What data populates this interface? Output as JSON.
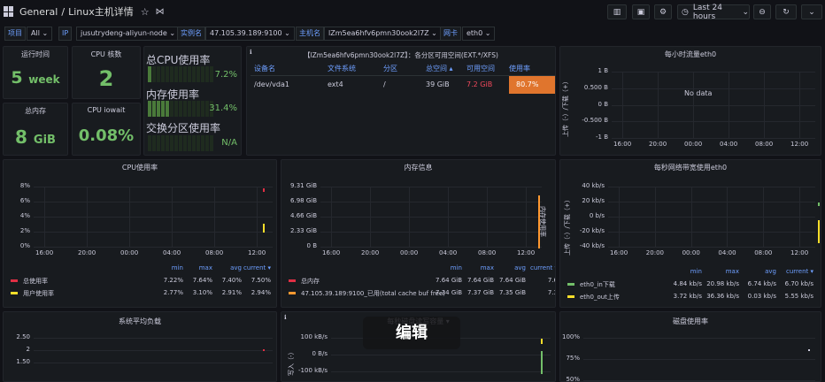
{
  "header": {
    "crumb_root": "General",
    "crumb_sep": "/",
    "crumb_title": "Linux主机详情",
    "time_range": "Last 24 hours"
  },
  "variables": [
    {
      "label": "项目",
      "value": "All"
    },
    {
      "label": "IP",
      "value": "jusutrydeng-aliyun-node"
    },
    {
      "label": "实例名",
      "value": "47.105.39.189:9100"
    },
    {
      "label": "主机名",
      "value": "lZm5ea6hfv6pmn30ook2l7Z"
    },
    {
      "label": "网卡",
      "value": "eth0"
    }
  ],
  "stats": {
    "uptime": {
      "title": "运行时间",
      "value": "5",
      "unit": "week"
    },
    "cpu_cores": {
      "title": "CPU 核数",
      "value": "2"
    },
    "mem_total": {
      "title": "总内存",
      "value": "8",
      "unit": "GiB"
    },
    "cpu_iowait": {
      "title": "CPU iowait",
      "value": "0.08%"
    }
  },
  "bargauges": [
    {
      "label": "总CPU使用率",
      "value": "7.2%",
      "fraction": 0.072
    },
    {
      "label": "内存使用率",
      "value": "31.4%",
      "fraction": 0.314
    },
    {
      "label": "交换分区使用率",
      "value": "N/A",
      "fraction": 0
    }
  ],
  "disk_table": {
    "title": "【lZm5ea6hfv6pmn30ook2l7Z】：各分区可用空间(EXT.*/XFS)",
    "columns": [
      "设备名",
      "文件系统",
      "分区",
      "总空间 ▴",
      "可用空间",
      "使用率"
    ],
    "rows": [
      [
        "/dev/vda1",
        "ext4",
        "/",
        "39 GiB",
        "7.2 GiB",
        "80.7%"
      ]
    ]
  },
  "traffic_hour": {
    "title": "每小时流量eth0",
    "no_data": "No data",
    "yticks": [
      "1 B",
      "0.500 B",
      "0 B",
      "-0.500 B",
      "-1 B"
    ],
    "xticks": [
      "16:00",
      "20:00",
      "00:00",
      "04:00",
      "08:00",
      "12:00"
    ],
    "ylabel": "上传（-）/下载（+）"
  },
  "cpu_panel": {
    "title": "CPU使用率",
    "yticks": [
      "8%",
      "6%",
      "4%",
      "2%",
      "0%"
    ],
    "xticks": [
      "16:00",
      "20:00",
      "00:00",
      "04:00",
      "08:00",
      "12:00"
    ],
    "legend_headers": [
      "min",
      "max",
      "avg",
      "current ▾"
    ],
    "legend": [
      {
        "name": "总使用率",
        "color": "#e02f44",
        "min": "7.22%",
        "max": "7.64%",
        "avg": "7.40%",
        "current": "7.50%"
      },
      {
        "name": "用户使用率",
        "color": "#fade2a",
        "min": "2.77%",
        "max": "3.10%",
        "avg": "2.91%",
        "current": "2.94%"
      }
    ]
  },
  "mem_panel": {
    "title": "内存信息",
    "yticks": [
      "9.31 GiB",
      "6.98 GiB",
      "4.66 GiB",
      "2.33 GiB",
      "0 B"
    ],
    "xticks": [
      "16:00",
      "20:00",
      "00:00",
      "04:00",
      "08:00",
      "12:00"
    ],
    "ylabel": "内存使用率",
    "legend_headers": [
      "min",
      "max",
      "avg",
      "current ▾"
    ],
    "legend": [
      {
        "name": "总内存",
        "color": "#e02f44",
        "min": "7.64 GiB",
        "max": "7.64 GiB",
        "avg": "7.64 GiB",
        "current": "7.6"
      },
      {
        "name": "47.105.39.189:9100_已用(total cache buf free)",
        "color": "#ff9830",
        "min": "7.34 GiB",
        "max": "7.37 GiB",
        "avg": "7.35 GiB",
        "current": "7.3"
      }
    ]
  },
  "net_panel": {
    "title": "每秒网络带宽使用eth0",
    "yticks": [
      "40 kb/s",
      "20 kb/s",
      "0 b/s",
      "-20 kb/s",
      "-40 kb/s"
    ],
    "xticks": [
      "16:00",
      "20:00",
      "00:00",
      "04:00",
      "08:00",
      "12:00"
    ],
    "ylabel": "上传（-）/下载（+）",
    "legend_headers": [
      "min",
      "max",
      "avg",
      "current ▾"
    ],
    "legend": [
      {
        "name": "eth0_in下载",
        "color": "#73bf69",
        "min": "4.84 kb/s",
        "max": "20.98 kb/s",
        "avg": "6.74 kb/s",
        "current": "6.70 kb/s"
      },
      {
        "name": "eth0_out上传",
        "color": "#fade2a",
        "min": "3.72 kb/s",
        "max": "36.36 kb/s",
        "avg": "0.03 kb/s",
        "current": "5.55 kb/s"
      }
    ]
  },
  "load_panel": {
    "title": "系统平均负载",
    "yticks": [
      "2.50",
      "2",
      "1.50"
    ]
  },
  "diskio_panel": {
    "title": "每秒磁盘读写容量 ▾",
    "yticks": [
      "100 kB/s",
      "0 B/s",
      "-100 kB/s"
    ],
    "ylabel": "写入（-）"
  },
  "diskuse_panel": {
    "title": "磁盘使用率",
    "yticks": [
      "100%",
      "75%",
      "50%"
    ]
  },
  "overlay": {
    "edit_label": "编辑"
  }
}
